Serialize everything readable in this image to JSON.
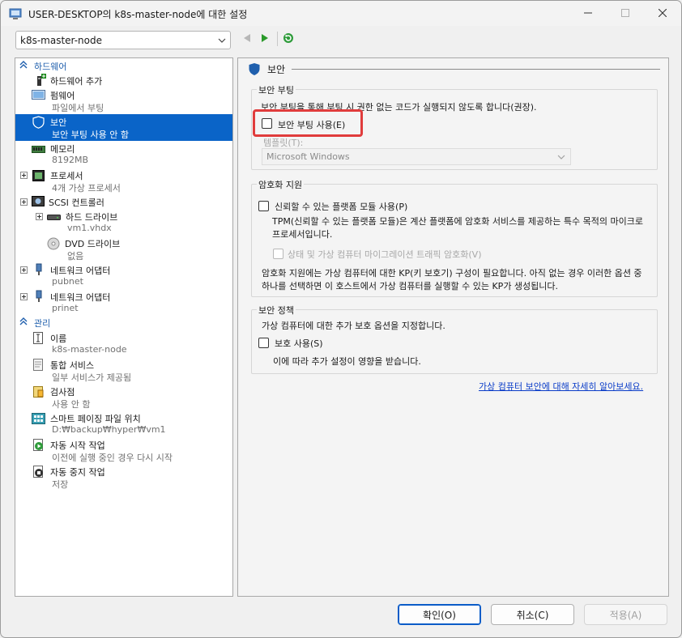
{
  "window": {
    "title": "USER-DESKTOP의 k8s-master-node에 대한 설정"
  },
  "toolbar": {
    "vm_selected": "k8s-master-node"
  },
  "sidebar": {
    "hardware_header": "하드웨어",
    "management_header": "관리",
    "hardware": [
      {
        "name": "하드웨어 추가",
        "sub": ""
      },
      {
        "name": "펌웨어",
        "sub": "파일에서 부팅"
      },
      {
        "name": "보안",
        "sub": "보안 부팅 사용 안 함"
      },
      {
        "name": "메모리",
        "sub": "8192MB"
      },
      {
        "name": "프로세서",
        "sub": "4개 가상 프로세서"
      },
      {
        "name": "SCSI 컨트롤러",
        "sub": ""
      },
      {
        "name": "하드 드라이브",
        "sub": "vm1.vhdx"
      },
      {
        "name": "DVD 드라이브",
        "sub": "없음"
      },
      {
        "name": "네트워크 어댑터",
        "sub": "pubnet"
      },
      {
        "name": "네트워크 어댑터",
        "sub": "prinet"
      }
    ],
    "management": [
      {
        "name": "이름",
        "sub": "k8s-master-node"
      },
      {
        "name": "통합 서비스",
        "sub": "일부 서비스가 제공됨"
      },
      {
        "name": "검사점",
        "sub": "사용 안 함"
      },
      {
        "name": "스마트 페이징 파일 위치",
        "sub": "D:₩backup₩hyper₩vm1"
      },
      {
        "name": "자동 시작 작업",
        "sub": "이전에 실행 중인 경우 다시 시작"
      },
      {
        "name": "자동 중지 작업",
        "sub": "저장"
      }
    ]
  },
  "content": {
    "header": "보안",
    "secure_boot": {
      "title": "보안 부팅",
      "desc": "보안 부팅을 통해 부팅 시 권한 없는 코드가 실행되지 않도록 합니다(권장).",
      "checkbox": "보안 부팅 사용(E)",
      "template_label": "템플릿(T):",
      "template_value": "Microsoft Windows"
    },
    "encryption": {
      "title": "암호화 지원",
      "tpm_checkbox": "신뢰할 수 있는 플랫폼 모듈 사용(P)",
      "tpm_desc": "TPM(신뢰할 수 있는 플랫폼 모듈)은 계산 플랫폼에 암호화 서비스를 제공하는 특수 목적의 마이크로프로세서입니다.",
      "migration_checkbox": "상태 및 가상 컴퓨터 마이그레이션 트래픽 암호화(V)",
      "kp_desc": "암호화 지원에는 가상 컴퓨터에 대한 KP(키 보호기) 구성이 필요합니다. 아직 없는 경우 이러한 옵션 중 하나를 선택하면 이 호스트에서 가상 컴퓨터를 실행할 수 있는 KP가 생성됩니다."
    },
    "policy": {
      "title": "보안 정책",
      "desc": "가상 컴퓨터에 대한 추가 보호 옵션을 지정합니다.",
      "checkbox": "보호 사용(S)",
      "note": "이에 따라 추가 설정이 영향을 받습니다."
    },
    "learn_more": "가상 컴퓨터 보안에 대해 자세히 알아보세요."
  },
  "buttons": {
    "ok": "확인(O)",
    "cancel": "취소(C)",
    "apply": "적용(A)"
  },
  "colors": {
    "selection": "#0a64c8",
    "highlight": "#e03c3c",
    "link": "#0a3cc8",
    "section_header": "#1f5fad"
  }
}
